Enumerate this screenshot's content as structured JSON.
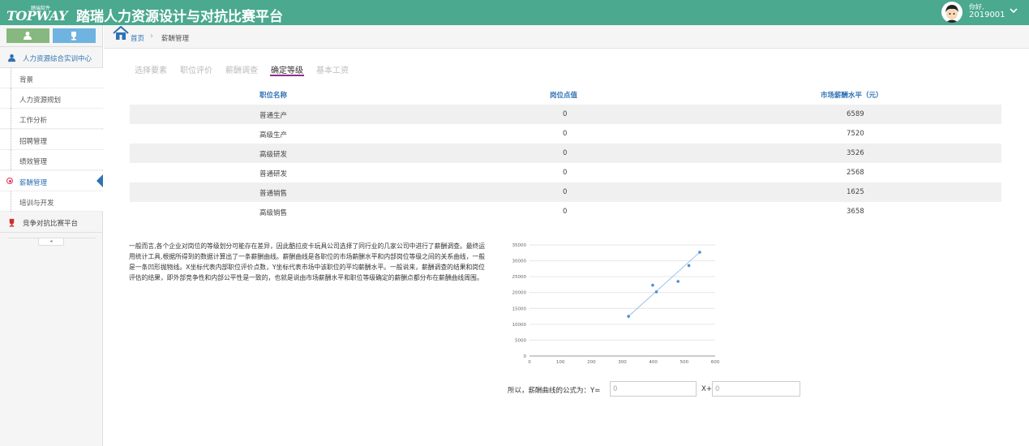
{
  "header": {
    "logo_small": "踏瑞软件",
    "logo_big": "TOPWAY",
    "title": "踏瑞人力资源设计与对抗比赛平台",
    "greeting": "你好,",
    "user_id": "2019001"
  },
  "sidebar": {
    "sections": [
      {
        "label": "人力资源综合实训中心",
        "icon": "user-icon"
      },
      {
        "label": "竞争对抗比赛平台",
        "icon": "trophy-icon"
      }
    ],
    "items": [
      {
        "label": "背景"
      },
      {
        "label": "人力资源规划"
      },
      {
        "label": "工作分析"
      },
      {
        "label": "招聘管理"
      },
      {
        "label": "绩效管理"
      },
      {
        "label": "薪酬管理",
        "active": true
      },
      {
        "label": "培训与开发"
      }
    ],
    "collapse_symbol": "◂"
  },
  "breadcrumb": {
    "home": "首页",
    "separator": "›",
    "current": "薪酬管理"
  },
  "tabs": [
    {
      "label": "选择要素"
    },
    {
      "label": "职位评价"
    },
    {
      "label": "薪酬调查"
    },
    {
      "label": "确定等级",
      "active": true
    },
    {
      "label": "基本工资"
    }
  ],
  "table": {
    "headers": [
      "职位名称",
      "岗位点值",
      "市场薪酬水平（元）"
    ],
    "rows": [
      [
        "普通生产",
        "0",
        "6589"
      ],
      [
        "高级生产",
        "0",
        "7520"
      ],
      [
        "高级研发",
        "0",
        "3526"
      ],
      [
        "普通研发",
        "0",
        "2568"
      ],
      [
        "普通销售",
        "0",
        "1625"
      ],
      [
        "高级销售",
        "0",
        "3658"
      ]
    ]
  },
  "description": "一般而言,各个企业对岗位的等级划分可能存在差异，因此酷拉皮卡玩具公司选择了同行业的几家公司中进行了薪酬调查。最终运用统计工具,根据所得到的数据计算出了一条薪酬曲线。薪酬曲线是各职位的市场薪酬水平和内部岗位等级之间的关系曲线，一般是一条凹形抛物线。X坐标代表内部职位评价点数，Y坐标代表市场中该职位的平均薪酬水平。一般说来，薪酬调查的结果和岗位评估的结果，即外部竞争性和内部公平性是一致的，也就是说由市场薪酬水平和职位等级确定的薪酬点都分布在薪酬曲线周围。",
  "chart_data": {
    "type": "scatter",
    "xlim": [
      0,
      600
    ],
    "ylim": [
      0,
      35000
    ],
    "x_ticks": [
      0,
      100,
      200,
      300,
      400,
      500,
      600
    ],
    "y_ticks": [
      0,
      5000,
      10000,
      15000,
      20000,
      25000,
      30000,
      35000
    ],
    "points": [
      {
        "x": 320,
        "y": 12500
      },
      {
        "x": 398,
        "y": 22300
      },
      {
        "x": 410,
        "y": 20200
      },
      {
        "x": 480,
        "y": 23500
      },
      {
        "x": 515,
        "y": 28500
      },
      {
        "x": 550,
        "y": 32700
      }
    ],
    "trendline": [
      {
        "x": 320,
        "y": 12500
      },
      {
        "x": 550,
        "y": 32700
      }
    ],
    "grid": true,
    "colors": {
      "point": "#4a90d9",
      "line": "#7fb4e6",
      "grid": "#e6e6e6"
    }
  },
  "formula": {
    "label": "所以，薪酬曲线的公式为：Y=",
    "a_value": "0",
    "x_plus": "X+",
    "b_value": "0"
  },
  "colors": {
    "header_bg": "#4aa98e",
    "link": "#2f72b3",
    "active_tab": "#8e2d8e"
  }
}
